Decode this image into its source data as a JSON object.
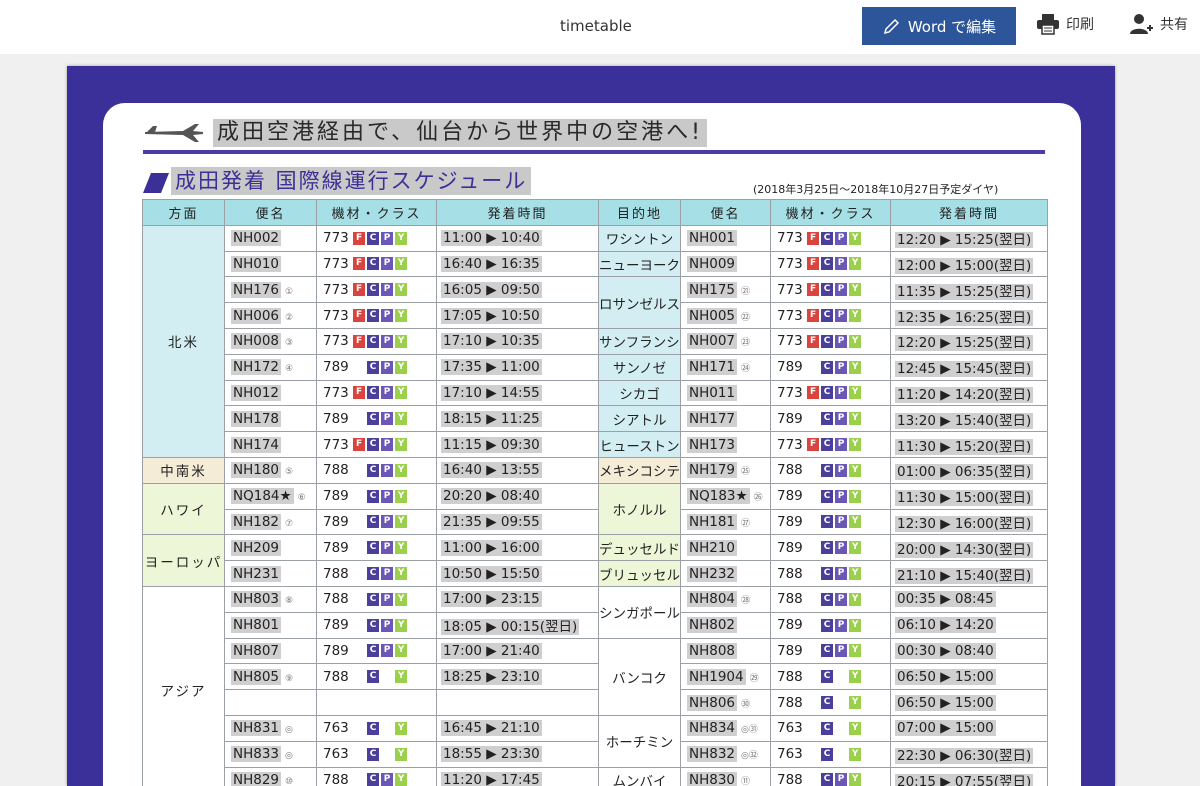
{
  "header": {
    "doc_title": "timetable",
    "word_button": "Word で編集",
    "print_label": "印刷",
    "share_label": "共有"
  },
  "doc": {
    "headline": "成田空港経由で、仙台から世界中の空港へ!",
    "subtitle": "成田発着 国際線運行スケジュール",
    "period": "(2018年3月25日～2018年10月27日予定ダイヤ)"
  },
  "table": {
    "headers": [
      "方面",
      "便名",
      "機材・クラス",
      "発着時間",
      "目的地",
      "便名",
      "機材・クラス",
      "発着時間"
    ]
  },
  "regions": {
    "na": "北米",
    "cs": "中南米",
    "hw": "ハワイ",
    "eu": "ヨーロッパ",
    "as": "アジア"
  },
  "destinations": {
    "was": "ワシントン",
    "nyc": "ニューヨーク",
    "lax": "ロサンゼルス",
    "sfo": "サンフランシスコ",
    "sjc": "サンノゼ",
    "chi": "シカゴ",
    "sea": "シアトル",
    "hou": "ヒューストン",
    "mex": "メキシコシティ",
    "hnl": "ホノルル",
    "dus": "デュッセルドルフ",
    "bru": "ブリュッセル",
    "sin": "シンガポール",
    "bkk": "バンコク",
    "sgn": "ホーチミン",
    "bom": "ムンバイ"
  },
  "rows": [
    {
      "f1": "NH002",
      "n1": "",
      "a1": "773",
      "c1": "FCPY",
      "t1": "11:00 ▶ 10:40",
      "f2": "NH001",
      "n2": "",
      "a2": "773",
      "c2": "FCPY",
      "t2": "12:20 ▶ 15:25(翌日)"
    },
    {
      "f1": "NH010",
      "n1": "",
      "a1": "773",
      "c1": "FCPY",
      "t1": "16:40 ▶ 16:35",
      "f2": "NH009",
      "n2": "",
      "a2": "773",
      "c2": "FCPY",
      "t2": "12:00 ▶ 15:00(翌日)"
    },
    {
      "f1": "NH176",
      "n1": "①",
      "a1": "773",
      "c1": "FCPY",
      "t1": "16:05 ▶ 09:50",
      "f2": "NH175",
      "n2": "㉑",
      "a2": "773",
      "c2": "FCPY",
      "t2": "11:35 ▶ 15:25(翌日)"
    },
    {
      "f1": "NH006",
      "n1": "②",
      "a1": "773",
      "c1": "FCPY",
      "t1": "17:05 ▶ 10:50",
      "f2": "NH005",
      "n2": "㉒",
      "a2": "773",
      "c2": "FCPY",
      "t2": "12:35 ▶ 16:25(翌日)"
    },
    {
      "f1": "NH008",
      "n1": "③",
      "a1": "773",
      "c1": "FCPY",
      "t1": "17:10 ▶ 10:35",
      "f2": "NH007",
      "n2": "㉓",
      "a2": "773",
      "c2": "FCPY",
      "t2": "12:20 ▶ 15:25(翌日)"
    },
    {
      "f1": "NH172",
      "n1": "④",
      "a1": "789",
      "c1": "CPY",
      "t1": "17:35 ▶ 11:00",
      "f2": "NH171",
      "n2": "㉔",
      "a2": "789",
      "c2": "CPY",
      "t2": "12:45 ▶ 15:45(翌日)"
    },
    {
      "f1": "NH012",
      "n1": "",
      "a1": "773",
      "c1": "FCPY",
      "t1": "17:10 ▶ 14:55",
      "f2": "NH011",
      "n2": "",
      "a2": "773",
      "c2": "FCPY",
      "t2": "11:20 ▶ 14:20(翌日)"
    },
    {
      "f1": "NH178",
      "n1": "",
      "a1": "789",
      "c1": "CPY",
      "t1": "18:15 ▶ 11:25",
      "f2": "NH177",
      "n2": "",
      "a2": "789",
      "c2": "CPY",
      "t2": "13:20 ▶ 15:40(翌日)"
    },
    {
      "f1": "NH174",
      "n1": "",
      "a1": "773",
      "c1": "FCPY",
      "t1": "11:15 ▶ 09:30",
      "f2": "NH173",
      "n2": "",
      "a2": "773",
      "c2": "FCPY",
      "t2": "11:30 ▶ 15:20(翌日)"
    },
    {
      "f1": "NH180",
      "n1": "⑤",
      "a1": "788",
      "c1": "CPY",
      "t1": "16:40 ▶ 13:55",
      "f2": "NH179",
      "n2": "㉕",
      "a2": "788",
      "c2": "CPY",
      "t2": "01:00 ▶ 06:35(翌日)"
    },
    {
      "f1": "NQ184★",
      "n1": "⑥",
      "a1": "789",
      "c1": "CPY",
      "t1": "20:20 ▶ 08:40",
      "f2": "NQ183★",
      "n2": "㉖",
      "a2": "789",
      "c2": "CPY",
      "t2": "11:30 ▶ 15:00(翌日)"
    },
    {
      "f1": "NH182",
      "n1": "⑦",
      "a1": "789",
      "c1": "CPY",
      "t1": "21:35 ▶ 09:55",
      "f2": "NH181",
      "n2": "㉗",
      "a2": "789",
      "c2": "CPY",
      "t2": "12:30 ▶ 16:00(翌日)"
    },
    {
      "f1": "NH209",
      "n1": "",
      "a1": "789",
      "c1": "CPY",
      "t1": "11:00 ▶ 16:00",
      "f2": "NH210",
      "n2": "",
      "a2": "789",
      "c2": "CPY",
      "t2": "20:00 ▶ 14:30(翌日)"
    },
    {
      "f1": "NH231",
      "n1": "",
      "a1": "788",
      "c1": "CPY",
      "t1": "10:50 ▶ 15:50",
      "f2": "NH232",
      "n2": "",
      "a2": "788",
      "c2": "CPY",
      "t2": "21:10 ▶ 15:40(翌日)"
    },
    {
      "f1": "NH803",
      "n1": "⑧",
      "a1": "788",
      "c1": "CPY",
      "t1": "17:00 ▶ 23:15",
      "f2": "NH804",
      "n2": "㉘",
      "a2": "788",
      "c2": "CPY",
      "t2": "00:35 ▶ 08:45"
    },
    {
      "f1": "NH801",
      "n1": "",
      "a1": "789",
      "c1": "CPY",
      "t1": "18:05 ▶ 00:15(翌日)",
      "f2": "NH802",
      "n2": "",
      "a2": "789",
      "c2": "CPY",
      "t2": "06:10 ▶ 14:20"
    },
    {
      "f1": "NH807",
      "n1": "",
      "a1": "789",
      "c1": "CPY",
      "t1": "17:00 ▶ 21:40",
      "f2": "NH808",
      "n2": "",
      "a2": "789",
      "c2": "CPY",
      "t2": "00:30 ▶ 08:40"
    },
    {
      "f1": "NH805",
      "n1": "⑨",
      "a1": "788",
      "c1": "C Y",
      "t1": "18:25 ▶ 23:10",
      "f2": "NH1904",
      "n2": "㉙",
      "a2": "788",
      "c2": "C Y",
      "t2": "06:50 ▶ 15:00"
    },
    {
      "f1": "",
      "n1": "",
      "a1": "",
      "c1": "",
      "t1": "",
      "f2": "NH806",
      "n2": "㉚",
      "a2": "788",
      "c2": "C Y",
      "t2": "06:50 ▶ 15:00"
    },
    {
      "f1": "NH831",
      "n1": "◎",
      "a1": "763",
      "c1": "C Y",
      "t1": "16:45 ▶ 21:10",
      "f2": "NH834",
      "n2": "◎㉛",
      "a2": "763",
      "c2": "C Y",
      "t2": "07:00 ▶ 15:00"
    },
    {
      "f1": "NH833",
      "n1": "◎",
      "a1": "763",
      "c1": "C Y",
      "t1": "18:55 ▶ 23:30",
      "f2": "NH832",
      "n2": "◎㉜",
      "a2": "763",
      "c2": "C Y",
      "t2": "22:30 ▶ 06:30(翌日)"
    },
    {
      "f1": "NH829",
      "n1": "⑩",
      "a1": "788",
      "c1": "CPY",
      "t1": "11:20 ▶ 17:45",
      "f2": "NH830",
      "n2": "⑪",
      "a2": "788",
      "c2": "CPY",
      "t2": "20:15 ▶ 07:55(翌日)"
    }
  ],
  "colors": {
    "frame": "#3b2f9a",
    "header_cell": "#a7dfe7",
    "class_F": "#d9443f",
    "class_C": "#4a3f9b",
    "class_P": "#6b57b5",
    "class_Y": "#9ad04b"
  }
}
